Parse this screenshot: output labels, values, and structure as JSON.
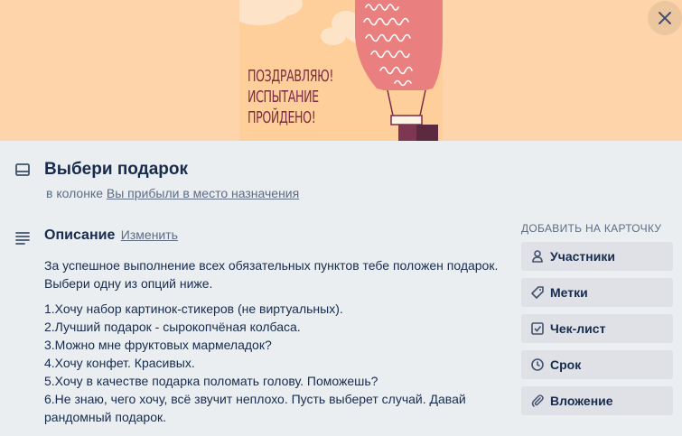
{
  "cover": {
    "lines": [
      "Поздравляю!",
      "испытание",
      "пройдено!"
    ]
  },
  "card": {
    "title": "Выбери подарок",
    "in_list_prefix": "в колонке",
    "list_name": "Вы прибыли в место назначения"
  },
  "description": {
    "heading": "Описание",
    "edit_label": "Изменить",
    "intro": "За успешное выполнение всех обязательных пунктов тебе положен подарок. Выбери одну из опций ниже.",
    "items": [
      "1.Хочу набор картинок-стикеров (не виртуальных).",
      "2.Лучший подарок - сырокопчёная колбаса.",
      "3.Можно мне фруктовых мармеладок?",
      "4.Хочу конфет. Красивых.",
      "5.Хочу в качестве подарка поломать голову. Поможешь?",
      "6.Не знаю, чего хочу, всё звучит неплохо. Пусть выберет случай. Давай рандомный подарок."
    ]
  },
  "sidebar": {
    "title": "ДОБАВИТЬ НА КАРТОЧКУ",
    "buttons": [
      {
        "label": "Участники",
        "icon": "person-icon"
      },
      {
        "label": "Метки",
        "icon": "label-icon"
      },
      {
        "label": "Чек-лист",
        "icon": "checklist-icon"
      },
      {
        "label": "Срок",
        "icon": "clock-icon"
      },
      {
        "label": "Вложение",
        "icon": "paperclip-icon"
      }
    ]
  },
  "colors": {
    "cover_bg": "#fed5ab",
    "cover_text": "#7d2b47",
    "balloon": "#ea7f7f",
    "panel_bg": "#ebeef0",
    "button_bg": "#dfe1e6",
    "text": "#172b4d",
    "muted": "#5e6c84"
  }
}
